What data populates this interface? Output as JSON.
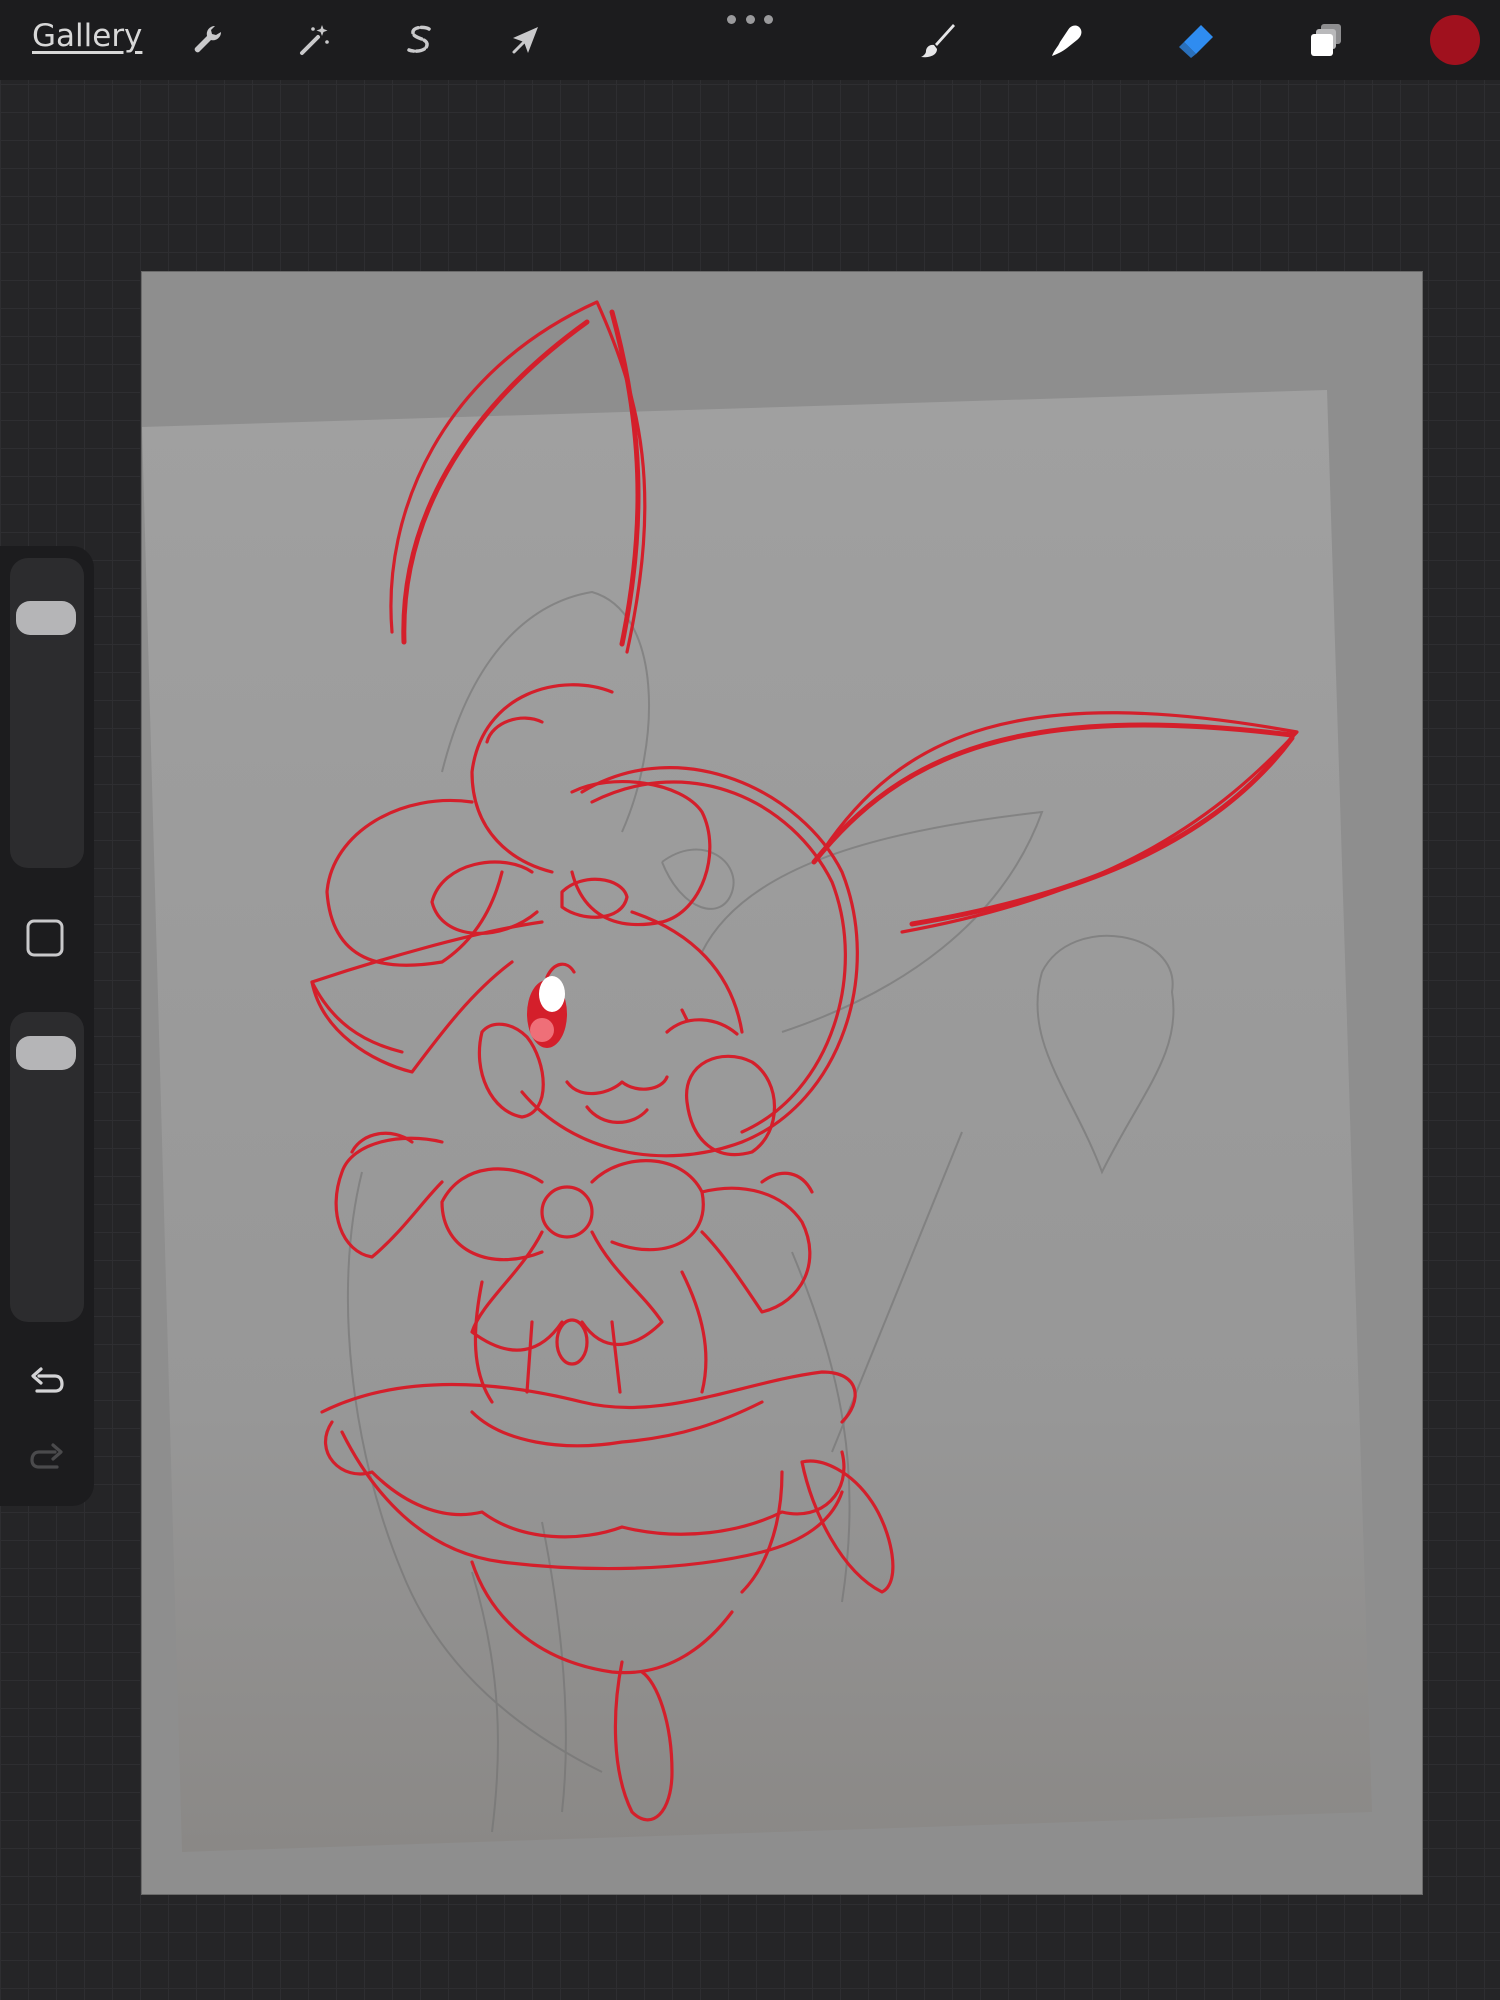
{
  "app": {
    "gallery_label": "Gallery",
    "accent_color": "#2f8cf0",
    "current_color": "#a0111e",
    "ink_color": "#d41f2b",
    "paper_color": "#9a9a9a"
  },
  "toolbar": {
    "left_tools": [
      {
        "name": "actions",
        "icon": "wrench-icon"
      },
      {
        "name": "adjustments",
        "icon": "magic-wand-icon"
      },
      {
        "name": "selection",
        "icon": "selection-s-icon"
      },
      {
        "name": "transform",
        "icon": "arrow-cursor-icon"
      }
    ],
    "right_tools": [
      {
        "name": "brush",
        "icon": "brush-icon",
        "active": false
      },
      {
        "name": "smudge",
        "icon": "smudge-finger-icon",
        "active": false
      },
      {
        "name": "eraser",
        "icon": "eraser-icon",
        "active": true
      },
      {
        "name": "layers",
        "icon": "layers-icon",
        "active": false
      }
    ]
  },
  "sidebar": {
    "brush_size_level": 0.14,
    "brush_opacity_level": 0.07
  }
}
